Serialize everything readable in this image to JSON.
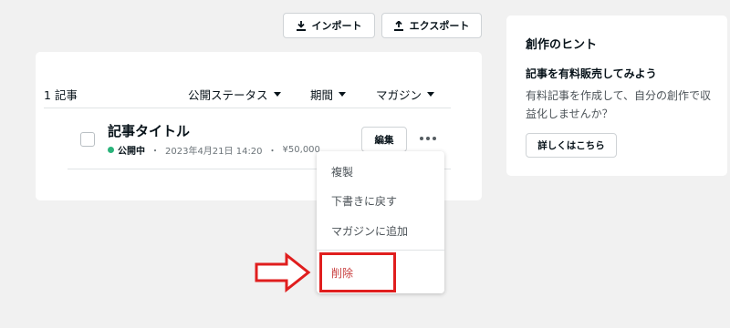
{
  "toolbar": {
    "import_label": "インポート",
    "export_label": "エクスポート"
  },
  "list": {
    "count_label": "1 記事",
    "filters": {
      "status": "公開ステータス",
      "period": "期間",
      "magazine": "マガジン"
    }
  },
  "article": {
    "title": "記事タイトル",
    "status": "公開中",
    "status_color": "#2ab37a",
    "separator": "・",
    "date": "2023年4月21日 14:20",
    "price": "¥50,000",
    "edit_label": "編集"
  },
  "menu": {
    "items": [
      "複製",
      "下書きに戻す",
      "マガジンに追加"
    ],
    "delete_label": "削除",
    "delete_color": "#c94040",
    "highlight_color": "#e01e1e"
  },
  "hint": {
    "title": "創作のヒント",
    "subtitle": "記事を有料販売してみよう",
    "body": "有料記事を作成して、自分の創作で収益化しませんか？",
    "button_label": "詳しくはこちら"
  }
}
